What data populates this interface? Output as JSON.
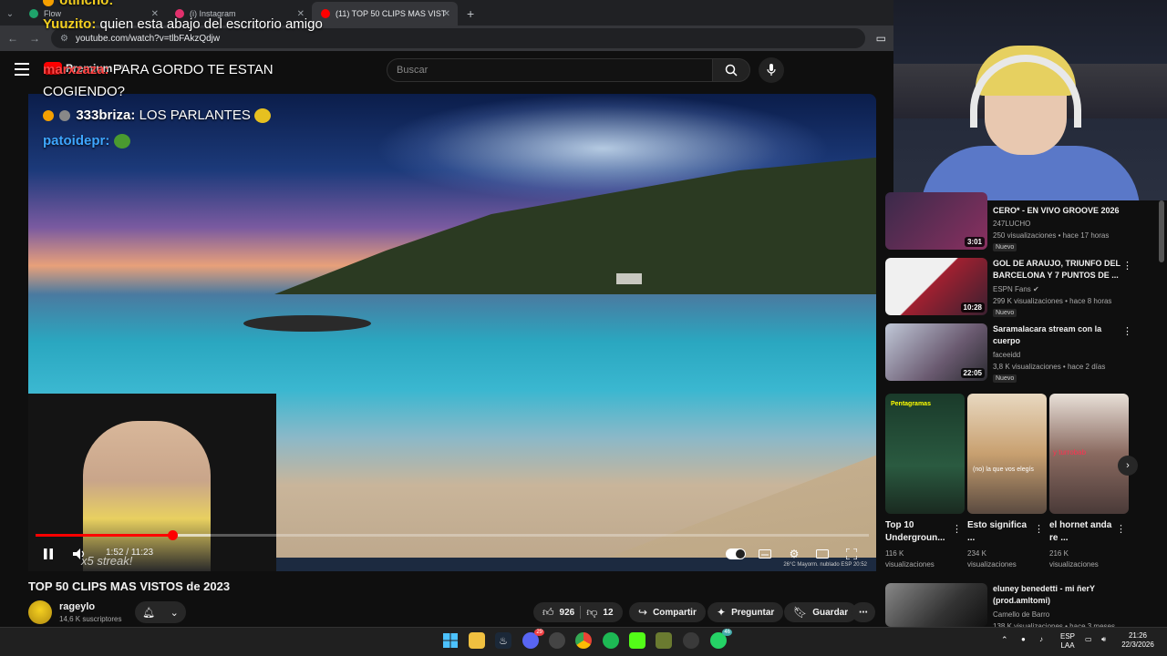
{
  "browser": {
    "tabs": [
      {
        "label": "Flow",
        "color": "#1fa36b"
      },
      {
        "label": "(i) Instagram",
        "color": "#e1306c"
      },
      {
        "label": "(11) TOP 50 CLIPS MAS VIST",
        "color": "#ff0000"
      }
    ],
    "url": "youtube.com/watch?v=tlbFAkzQdjw"
  },
  "youtube": {
    "logo_text": "Premium",
    "logo_region": "AR",
    "search_placeholder": "Buscar"
  },
  "chat": [
    {
      "user": "otincho:",
      "message": "",
      "color": "#f5d020"
    },
    {
      "user": "Yuuzito:",
      "message": "quien esta abajo del escritorio amigo",
      "color": "#f5d020"
    },
    {
      "user": "marxzaza:",
      "message": "PARA GORDO TE ESTAN",
      "color": "#ff4444"
    },
    {
      "user": "",
      "message": "COGIENDO?",
      "color": "#ffffff"
    },
    {
      "user": "333briza:",
      "message": "LOS PARLANTES",
      "color": "#ffffff"
    },
    {
      "user": "patoidepr:",
      "message": "",
      "color": "#3ea6ff"
    }
  ],
  "player": {
    "current_time": "1:52",
    "duration": "11:23",
    "played_fraction": 0.164,
    "buffer_fraction": 0.21,
    "overlay_text": "x5 streak!",
    "inner_taskbar": "26°C  Mayorm. nublado   ESP  20:52"
  },
  "video": {
    "title": "TOP 50 CLIPS MAS VISTOS de 2023",
    "channel": "rageylo",
    "subscribers": "14,6 K suscriptores",
    "likes": "926",
    "dislikes": "12",
    "share": "Compartir",
    "ask": "Preguntar",
    "save": "Guardar"
  },
  "recommendations": [
    {
      "title": "CERO* - EN VIVO GROOVE 2026",
      "channel": "247LUCHO",
      "meta": "250 visualizaciones • hace 17 horas",
      "badge": "Nuevo",
      "duration": "3:01",
      "color": "#3a2a4a"
    },
    {
      "title": "GOL DE ARAUJO, TRIUNFO DEL BARCELONA Y 7 PUNTOS DE ...",
      "channel": "ESPN Fans",
      "meta": "299 K visualizaciones • hace 8 horas",
      "badge": "Nuevo",
      "duration": "10:28",
      "color": "#a02030"
    },
    {
      "title": "Saramalacara stream con la cuerpo",
      "channel": "faceeidd",
      "meta": "3,8 K visualizaciones • hace 2 días",
      "badge": "Nuevo",
      "duration": "22:05",
      "color": "#6a5a70"
    },
    {
      "title": "eluney benedetti - mi ñerY (prod.amltomi)",
      "channel": "Camello de Barro",
      "meta": "138 K visualizaciones • hace 3 meses",
      "badge": "",
      "duration": "",
      "color": "#555555"
    }
  ],
  "shorts": [
    {
      "title": "Top 10 Undergroun...",
      "views": "116 K",
      "unit": "visualizaciones",
      "color": "#2a5a40"
    },
    {
      "title": "Esto significa ...",
      "views": "234 K",
      "unit": "visualizaciones",
      "color": "#c8a070"
    },
    {
      "title": "el hornet anda re ...",
      "views": "216 K",
      "unit": "visualizaciones",
      "color": "#8a6a60"
    }
  ],
  "short_overlays": [
    "Pentagramas",
    "(no) la que vos elegís",
    "y turrobab"
  ],
  "taskbar": {
    "lang": "ESP",
    "lang2": "LAA",
    "time": "21:26",
    "date": "22/3/2026",
    "discord_badge": "29",
    "whatsapp_badge": "46"
  }
}
